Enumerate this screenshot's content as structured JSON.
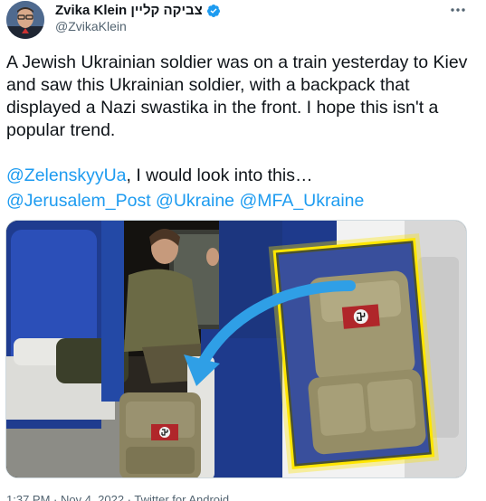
{
  "author": {
    "display_name": "Zvika Klein צביקה קליין",
    "handle": "@ZvikaKlein"
  },
  "icons": {
    "verified": "verified-badge-icon",
    "more": "more-options-icon"
  },
  "colors": {
    "link": "#1d9bf0",
    "text": "#0f1419",
    "secondary": "#536471",
    "arrow": "#2f9fe6",
    "highlight": "#ffe600"
  },
  "tweet": {
    "text": "A Jewish Ukrainian soldier was on a train yesterday to Kiev and saw this Ukrainian soldier, with a backpack that displayed a Nazi swastika in the front. I hope this isn't a popular trend.",
    "line2_mention": "@ZelenskyyUa",
    "line2_rest": ", I would look into this…",
    "mentions": [
      "@Jerusalem_Post",
      "@Ukraine",
      "@MFA_Ukraine"
    ]
  },
  "footer": {
    "meta": "1:37 PM · Nov 4, 2022 · Twitter for Android"
  }
}
